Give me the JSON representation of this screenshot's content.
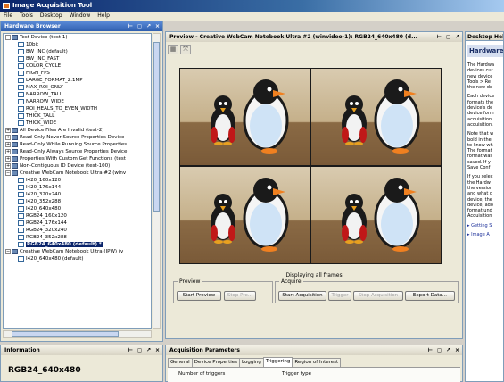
{
  "window": {
    "title": "Image Acquisition Tool"
  },
  "menu": [
    "File",
    "Tools",
    "Desktop",
    "Window",
    "Help"
  ],
  "hardware_browser": {
    "title": "Hardware Browser",
    "tree": [
      {
        "label": "Test Device (test-1)",
        "level": 0,
        "type": "device",
        "expander": "⊟"
      },
      {
        "label": "10bit",
        "level": 1,
        "type": "format"
      },
      {
        "label": "BW_INC (default)",
        "level": 1,
        "type": "format"
      },
      {
        "label": "BW_INC_FAST",
        "level": 1,
        "type": "format"
      },
      {
        "label": "COLOR_CYCLE",
        "level": 1,
        "type": "format"
      },
      {
        "label": "HIGH_FPS",
        "level": 1,
        "type": "format"
      },
      {
        "label": "LARGE_FORMAT_2.1MP",
        "level": 1,
        "type": "format"
      },
      {
        "label": "MAX_ROI_ONLY",
        "level": 1,
        "type": "format"
      },
      {
        "label": "NARROW_TALL",
        "level": 1,
        "type": "format"
      },
      {
        "label": "NARROW_WIDE",
        "level": 1,
        "type": "format"
      },
      {
        "label": "ROI_HEALS_TO_EVEN_WIDTH",
        "level": 1,
        "type": "format"
      },
      {
        "label": "THICK_TALL",
        "level": 1,
        "type": "format"
      },
      {
        "label": "THICK_WIDE",
        "level": 1,
        "type": "format"
      },
      {
        "label": "All Device Files Are Invalid (test-2)",
        "level": 0,
        "type": "device",
        "expander": "⊞"
      },
      {
        "label": "Read-Only Never Source Properties Device",
        "level": 0,
        "type": "device",
        "expander": "⊞"
      },
      {
        "label": "Read-Only While Running Source Properties",
        "level": 0,
        "type": "device",
        "expander": "⊞"
      },
      {
        "label": "Read-Only Always Source Properties Device",
        "level": 0,
        "type": "device",
        "expander": "⊞"
      },
      {
        "label": "Properties With Custom Get Functions (test",
        "level": 0,
        "type": "device",
        "expander": "⊞"
      },
      {
        "label": "Non-Contiguous ID Device (test-100)",
        "level": 0,
        "type": "device",
        "expander": "⊞"
      },
      {
        "label": "Creative WebCam Notebook Ultra #2 (winv",
        "level": 0,
        "type": "device",
        "expander": "⊟"
      },
      {
        "label": "I420_160x120",
        "level": 1,
        "type": "format"
      },
      {
        "label": "I420_176x144",
        "level": 1,
        "type": "format"
      },
      {
        "label": "I420_320x240",
        "level": 1,
        "type": "format"
      },
      {
        "label": "I420_352x288",
        "level": 1,
        "type": "format"
      },
      {
        "label": "I420_640x480",
        "level": 1,
        "type": "format"
      },
      {
        "label": "RGB24_160x120",
        "level": 1,
        "type": "format"
      },
      {
        "label": "RGB24_176x144",
        "level": 1,
        "type": "format"
      },
      {
        "label": "RGB24_320x240",
        "level": 1,
        "type": "format"
      },
      {
        "label": "RGB24_352x288",
        "level": 1,
        "type": "format"
      },
      {
        "label": "RGB24_640x480 (default) *",
        "level": 1,
        "type": "format",
        "selected": true
      },
      {
        "label": "Creative WebCam Notebook Ultra (IPW) (v",
        "level": 0,
        "type": "device",
        "expander": "⊟"
      },
      {
        "label": "I420_640x480 (default)",
        "level": 1,
        "type": "format"
      }
    ]
  },
  "information": {
    "title": "Information",
    "text": "RGB24_640x480"
  },
  "preview": {
    "title": "Preview - Creative WebCam Notebook Ultra #2 (winvideo-1): RGB24_640x480 (d...",
    "caption": "Displaying all frames.",
    "preview_group": "Preview",
    "start_preview": "Start Preview",
    "stop_preview": "Stop Pre...",
    "acquire_group": "Acquire",
    "start_acquisition": "Start Acquisition",
    "trigger": "Trigger",
    "stop_acquisition": "Stop Acquisition",
    "export_data": "Export Data..."
  },
  "acquisition_parameters": {
    "title": "Acquisition Parameters",
    "tabs": [
      "General",
      "Device Properties",
      "Logging",
      "Triggering",
      "Region of Interest"
    ],
    "active_tab": "Triggering",
    "number_of_triggers": "Number of triggers",
    "trigger_type": "Trigger type"
  },
  "desktop_help": {
    "title": "Desktop Help",
    "heading": "Hardware",
    "paragraphs": [
      "The Hardwa\ndevices cur\nnew device\nTools > Re\nthe new de",
      "Each device\nformats the\ndevice's de\ndevice form\nacquisition.\nacquisition.",
      "Note that w\nbold in the\nto know wh\nThe format\nformat was\nsaved. If y\nSave Conf",
      "If you selec\nthe Hardw\nthe version\nand what d\ndevice, the\ndevice, ado\nformat und\nAcquisition"
    ],
    "links": [
      "Getting S",
      "Image A"
    ]
  },
  "panel_buttons": "⊢ ◻ ✗ ×"
}
